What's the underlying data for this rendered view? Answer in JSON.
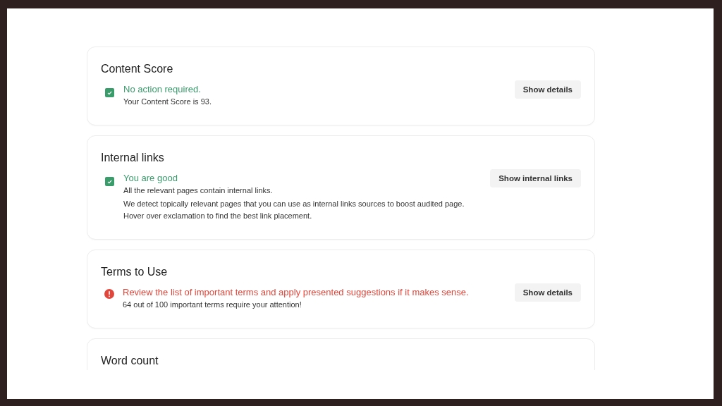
{
  "sections": [
    {
      "title": "Content Score",
      "kind": "ok",
      "headline": "No action required.",
      "lines": [
        "Your Content Score is 93."
      ],
      "button": "Show details"
    },
    {
      "title": "Internal links",
      "kind": "ok",
      "headline": "You are good",
      "lines": [
        "All the relevant pages contain internal links.",
        "We detect topically relevant pages that you can use as internal links sources to boost audited page. Hover over exclamation to find the best link placement."
      ],
      "button": "Show internal links"
    },
    {
      "title": "Terms to Use",
      "kind": "warning",
      "headline": "Review the list of important terms and apply presented suggestions if it makes sense.",
      "lines": [
        "64 out of 100 important terms require your attention!"
      ],
      "button": "Show details"
    },
    {
      "title": "Word count"
    }
  ]
}
